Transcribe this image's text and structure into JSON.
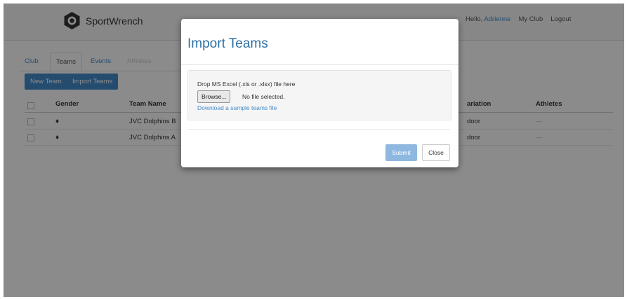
{
  "brand": {
    "name": "SportWrench",
    "logo_icon": "hex-nut-icon"
  },
  "user_nav": {
    "greeting": "Hello,",
    "username": "Adrienne",
    "my_club": "My Club",
    "logout": "Logout"
  },
  "tabs": [
    {
      "label": "Club",
      "active": false
    },
    {
      "label": "Teams",
      "active": true
    },
    {
      "label": "Events",
      "active": false
    },
    {
      "label": "Athletes",
      "active": false
    }
  ],
  "actions": {
    "new_team": "New Team",
    "import_teams": "Import Teams"
  },
  "table": {
    "columns": [
      "Gender",
      "Team Name",
      "ariation",
      "Athletes"
    ],
    "rows": [
      {
        "gender_icon": "gender-symbol-icon",
        "team_name": "JVC Dolphins B",
        "variation": "door",
        "athletes": "—"
      },
      {
        "gender_icon": "gender-symbol-icon",
        "team_name": "JVC Dolphins A",
        "variation": "door",
        "athletes": "—"
      }
    ]
  },
  "modal": {
    "title": "Import Teams",
    "drop_text": "Drop MS Excel (.xls or .xlsx) file here",
    "browse_label": "Browse...",
    "file_status": "No file selected.",
    "sample_link": "Download a sample teams file",
    "submit_label": "Submit",
    "close_label": "Close"
  },
  "colors": {
    "accent": "#428bca",
    "title": "#2b6fa5",
    "submit_disabled": "#8fb8e0"
  }
}
